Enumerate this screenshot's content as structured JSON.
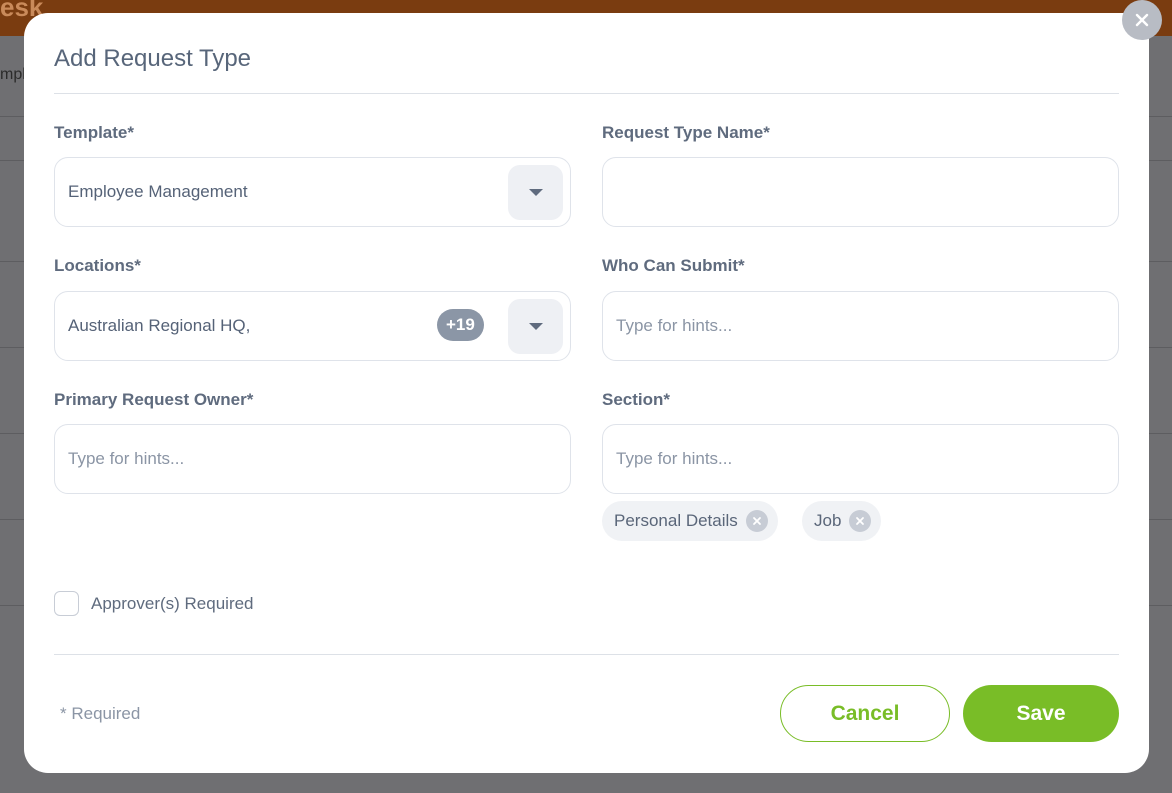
{
  "background": {
    "app_title": "esk",
    "sub_text": "mpl"
  },
  "modal": {
    "title": "Add Request Type",
    "close_icon": "close-icon"
  },
  "form": {
    "template": {
      "label": "Template*",
      "value": "Employee Management"
    },
    "request_type_name": {
      "label": "Request Type Name*",
      "value": ""
    },
    "locations": {
      "label": "Locations*",
      "value": "Australian Regional HQ,",
      "extra_count": "+19"
    },
    "who_can_submit": {
      "label": "Who Can Submit*",
      "placeholder": "Type for hints..."
    },
    "primary_request_owner": {
      "label": "Primary Request Owner*",
      "placeholder": "Type for hints..."
    },
    "section": {
      "label": "Section*",
      "placeholder": "Type for hints...",
      "chips": [
        {
          "label": "Personal Details"
        },
        {
          "label": "Job"
        }
      ]
    },
    "approvers": {
      "label": "Approver(s) Required",
      "checked": false
    }
  },
  "footer": {
    "required_note": "* Required",
    "cancel_label": "Cancel",
    "save_label": "Save"
  },
  "colors": {
    "accent": "#79bd27",
    "text": "#5f6b7e",
    "border": "#dfe3ea"
  }
}
